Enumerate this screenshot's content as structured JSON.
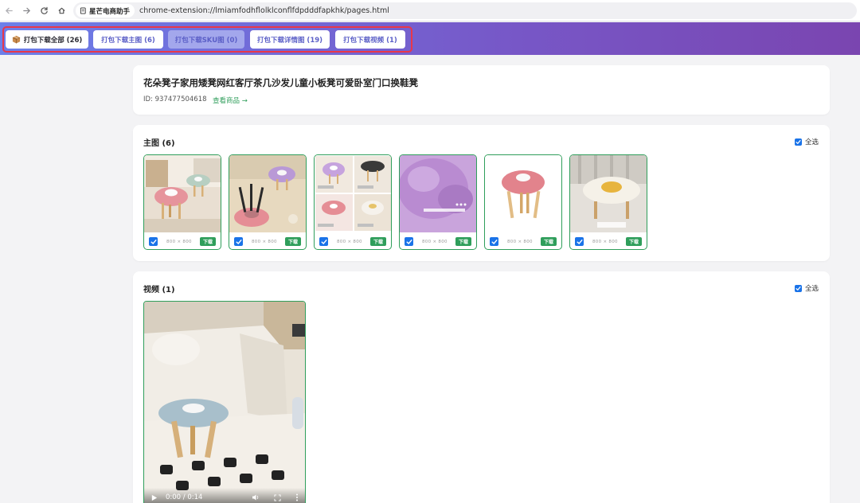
{
  "browser": {
    "site_name": "星芒电商助手",
    "url": "chrome-extension://lmiamfodhflolklconflfdpdddfapkhk/pages.html"
  },
  "toolbar": {
    "buttons": [
      {
        "label": "打包下载全部 (26)",
        "state": "active",
        "icon": "package-icon"
      },
      {
        "label": "打包下载主图 (6)",
        "state": "normal"
      },
      {
        "label": "打包下载SKU图 (0)",
        "state": "disabled"
      },
      {
        "label": "打包下载详情图 (19)",
        "state": "normal"
      },
      {
        "label": "打包下载视频 (1)",
        "state": "normal"
      }
    ]
  },
  "product": {
    "title": "花朵凳子家用矮凳网红客厅茶几沙发儿童小板凳可爱卧室门口换鞋凳",
    "id_text": "ID: 937477504618",
    "view_link": "查看商品 →"
  },
  "main_images": {
    "title": "主图 (6)",
    "select_all": "全选",
    "items": [
      {
        "dims": "800 × 800",
        "download": "下载",
        "checked": true
      },
      {
        "dims": "800 × 800",
        "download": "下载",
        "checked": true
      },
      {
        "dims": "800 × 800",
        "download": "下载",
        "checked": true
      },
      {
        "dims": "800 × 800",
        "download": "下载",
        "checked": true
      },
      {
        "dims": "800 × 800",
        "download": "下载",
        "checked": true
      },
      {
        "dims": "800 × 800",
        "download": "下载",
        "checked": true
      }
    ]
  },
  "videos": {
    "title": "视频 (1)",
    "select_all": "全选",
    "player": {
      "time": "0:00 / 0:14"
    }
  },
  "colors": {
    "accent_green": "#2f9e5b",
    "toolbar_purple": "#7757c7",
    "highlight_red": "#e8374a",
    "checkbox_blue": "#1a73e8"
  }
}
